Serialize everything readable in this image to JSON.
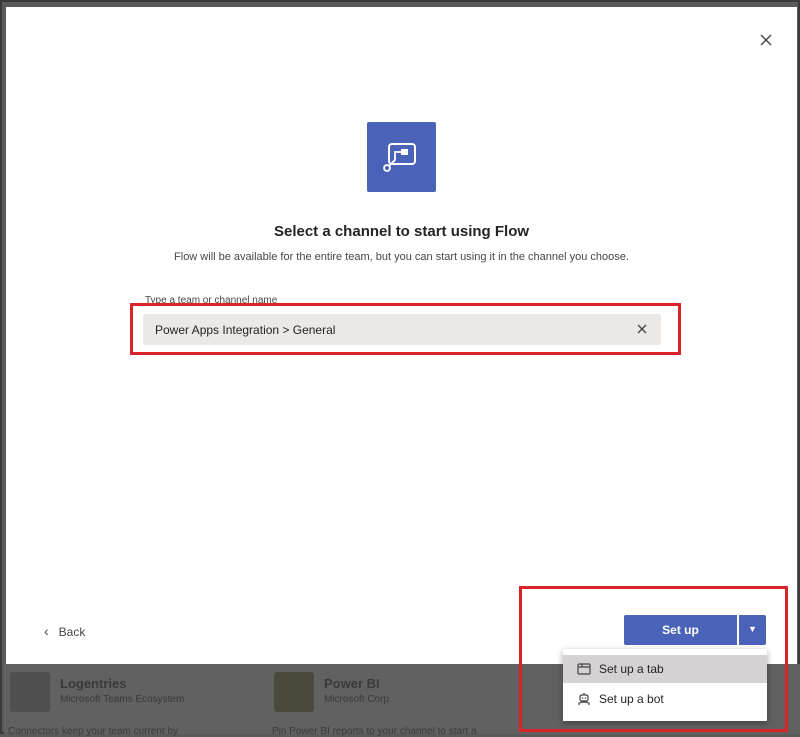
{
  "dialog": {
    "title": "Select a channel to start using Flow",
    "subtitle": "Flow will be available for the entire team, but you can start using it in the channel you choose.",
    "field_label": "Type a team or channel name",
    "field_value": "Power Apps Integration > General",
    "close_icon": "close-icon",
    "clear_icon": "clear-icon"
  },
  "footer": {
    "back_label": "Back",
    "setup_label": "Set up"
  },
  "setup_menu": {
    "items": [
      {
        "label": "Set up a tab",
        "icon": "tab-icon",
        "selected": true
      },
      {
        "label": "Set up a bot",
        "icon": "bot-icon",
        "selected": false
      }
    ]
  },
  "background_apps": [
    {
      "title": "Logentries",
      "subtitle": "Microsoft Teams Ecosystem",
      "description": "Connectors keep your team current by"
    },
    {
      "title": "Power BI",
      "subtitle": "Microsoft Corp.",
      "description": "Pin Power BI reports to your channel to start a"
    }
  ],
  "colors": {
    "accent": "#4a63b8",
    "highlight": "#d9242a",
    "field_bg": "#ebe8e5"
  }
}
